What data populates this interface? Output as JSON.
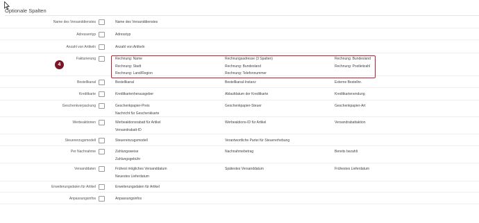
{
  "section": {
    "title": "Optionale Spalten"
  },
  "rows": [
    {
      "label": "Name des Versanddienstes",
      "cols": [
        [
          "Name des Versanddienstes"
        ],
        [],
        []
      ]
    },
    {
      "label": "Adressentyp",
      "cols": [
        [
          "Adresstyp"
        ],
        [],
        []
      ]
    },
    {
      "label": "Anzahl von Artikeln",
      "cols": [
        [
          "Anzahl von Artikeln"
        ],
        [],
        []
      ]
    },
    {
      "label": "Fakturierung",
      "cols": [
        [
          "Rechnung: Name",
          "Rechnung: Stadt",
          "Rechnung: Land/Region"
        ],
        [
          "Rechnungsadresse (3 Spalten)",
          "Rechnung: Bundesland",
          "Rechnung: Telefonnummer"
        ],
        [
          "Rechnung: Bundesland",
          "Rechnung: Postleitzahl"
        ]
      ]
    },
    {
      "label": "Bestellkanal",
      "cols": [
        [
          "Bestellkanal"
        ],
        [
          "Bestellkanal-Instanz"
        ],
        [
          "Externe Bestellnr."
        ]
      ]
    },
    {
      "label": "Kreditkarte",
      "cols": [
        [
          "Kreditkartenherausgeber"
        ],
        [
          "Ablaufdatum der Kreditkarte"
        ],
        [
          "Kreditkartenendung"
        ]
      ]
    },
    {
      "label": "Geschenkverpackung",
      "cols": [
        [
          "Geschenkpapier-Preis",
          "Nachricht für Geschenkkarte"
        ],
        [
          "Geschenkpapier-Steuer"
        ],
        [
          "Geschenkpapier-Art"
        ]
      ]
    },
    {
      "label": "Werbeaktionen",
      "cols": [
        [
          "Werbeaktionsrabatt für Artikel",
          "Versandrabatt-ID"
        ],
        [
          "Werbeaktions-ID für Artikel"
        ],
        [
          "Versandrabattaktion"
        ]
      ]
    },
    {
      "label": "Steuererzugsmodell",
      "cols": [
        [
          "Steuereinzugsmodell"
        ],
        [
          "Verantwortliche Partei für Steuererhebung"
        ],
        []
      ]
    },
    {
      "label": "Per Nachnahme",
      "cols": [
        [
          "Zahlungsweise",
          "Zahlungsgebühr"
        ],
        [
          "Nachnahmebetrag"
        ],
        [
          "Bereits bezahlt"
        ]
      ]
    },
    {
      "label": "Versanddaten",
      "cols": [
        [
          "Frühest mögliches Versanddatum",
          "Neuestes Lieferdatum"
        ],
        [
          "Spätestes Versanddatum"
        ],
        [
          "Frühestes Lieferdatum"
        ]
      ]
    },
    {
      "label": "Erweiterungsdaten für Artikel",
      "cols": [
        [
          "Erweiterungsdaten für Artikel"
        ],
        [],
        []
      ]
    },
    {
      "label": "Anpassungsinfos",
      "cols": [
        [
          "Anpassungsinfos"
        ],
        [],
        []
      ]
    }
  ],
  "annotation": {
    "step_number": "4",
    "color": "#c01b2e"
  }
}
